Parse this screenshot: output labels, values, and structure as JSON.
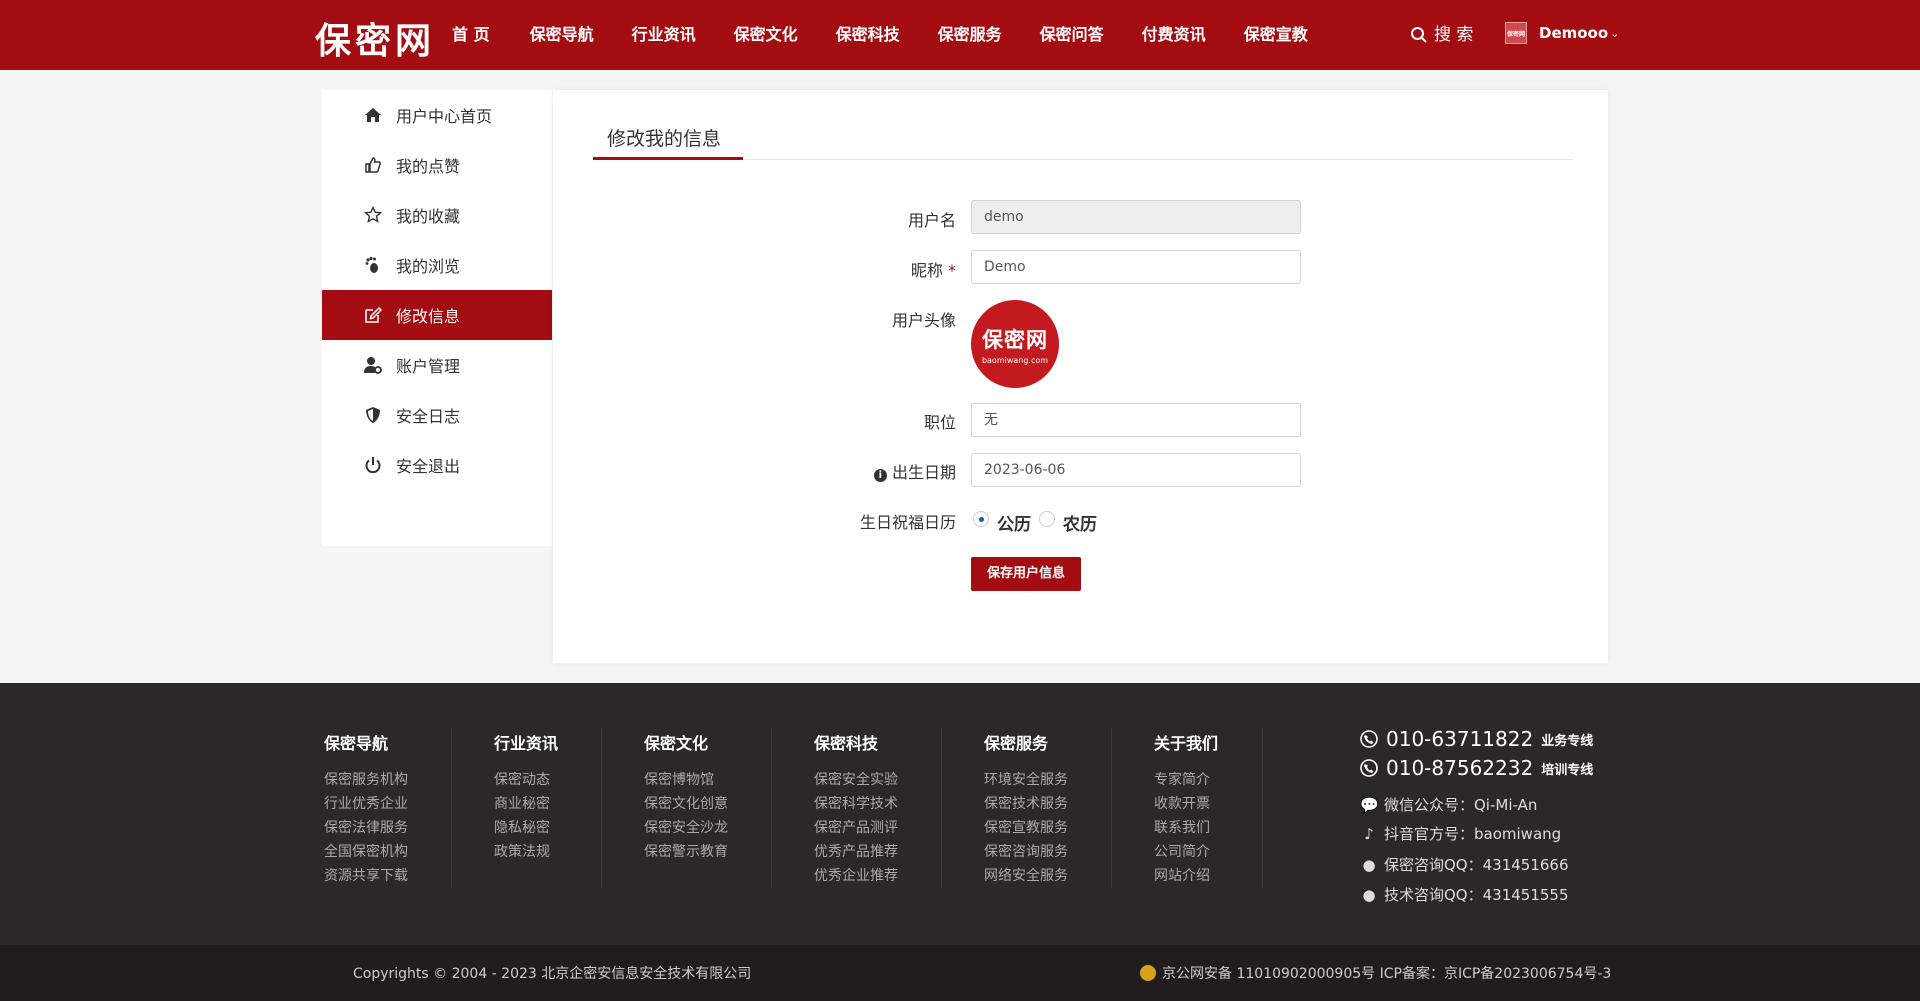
{
  "header": {
    "logo": "保密网",
    "nav": [
      "首 页",
      "保密导航",
      "行业资讯",
      "保密文化",
      "保密科技",
      "保密服务",
      "保密问答",
      "付费资讯",
      "保密宣教"
    ],
    "search_label": "搜 索",
    "user_avatar_text": "保密网",
    "user_name": "Demooo"
  },
  "sidebar": {
    "items": [
      {
        "label": "用户中心首页",
        "icon": "home-icon"
      },
      {
        "label": "我的点赞",
        "icon": "thumbs-up-icon"
      },
      {
        "label": "我的收藏",
        "icon": "star-icon"
      },
      {
        "label": "我的浏览",
        "icon": "footprint-icon"
      },
      {
        "label": "修改信息",
        "icon": "edit-icon"
      },
      {
        "label": "账户管理",
        "icon": "user-gear-icon"
      },
      {
        "label": "安全日志",
        "icon": "shield-icon"
      },
      {
        "label": "安全退出",
        "icon": "power-icon"
      }
    ],
    "active_index": 4
  },
  "form": {
    "title": "修改我的信息",
    "username_label": "用户名",
    "username_value": "demo",
    "nickname_label": "昵称",
    "nickname_required": "*",
    "nickname_value": "Demo",
    "avatar_label": "用户头像",
    "avatar_text": "保密网",
    "avatar_subtext": "baomiwang.com",
    "position_label": "职位",
    "position_value": "无",
    "birthday_label": "出生日期",
    "birthday_value": "2023-06-06",
    "calendar_label": "生日祝福日历",
    "calendar_options": [
      "公历",
      "农历"
    ],
    "calendar_selected": "公历",
    "save_label": "保存用户信息"
  },
  "footer": {
    "columns": [
      {
        "title": "保密导航",
        "links": [
          "保密服务机构",
          "行业优秀企业",
          "保密法律服务",
          "全国保密机构",
          "资源共享下载"
        ]
      },
      {
        "title": "行业资讯",
        "links": [
          "保密动态",
          "商业秘密",
          "隐私秘密",
          "政策法规"
        ]
      },
      {
        "title": "保密文化",
        "links": [
          "保密博物馆",
          "保密文化创意",
          "保密安全沙龙",
          "保密警示教育"
        ]
      },
      {
        "title": "保密科技",
        "links": [
          "保密安全实验",
          "保密科学技术",
          "保密产品测评",
          "优秀产品推荐",
          "优秀企业推荐"
        ]
      },
      {
        "title": "保密服务",
        "links": [
          "环境安全服务",
          "保密技术服务",
          "保密宣教服务",
          "保密咨询服务",
          "网络安全服务"
        ]
      },
      {
        "title": "关于我们",
        "links": [
          "专家简介",
          "收款开票",
          "联系我们",
          "公司简介",
          "网站介绍"
        ]
      }
    ],
    "phones": [
      {
        "number": "010-63711822",
        "tag": "业务专线"
      },
      {
        "number": "010-87562232",
        "tag": "培训专线"
      }
    ],
    "social": [
      {
        "icon": "wechat-icon",
        "text": "微信公众号：Qi-Mi-An"
      },
      {
        "icon": "tiktok-icon",
        "text": "抖音官方号：baomiwang"
      },
      {
        "icon": "qq-icon",
        "text": "保密咨询QQ：431451666"
      },
      {
        "icon": "qq-icon",
        "text": "技术咨询QQ：431451555"
      }
    ],
    "copyright": "Copyrights © 2004 - 2023 北京企密安信息安全技术有限公司",
    "icp": "京公网安备 11010902000905号 ICP备案：京ICP备2023006754号-3"
  },
  "colors": {
    "brand": "#a30d11",
    "footer_bg": "#2a2828"
  }
}
